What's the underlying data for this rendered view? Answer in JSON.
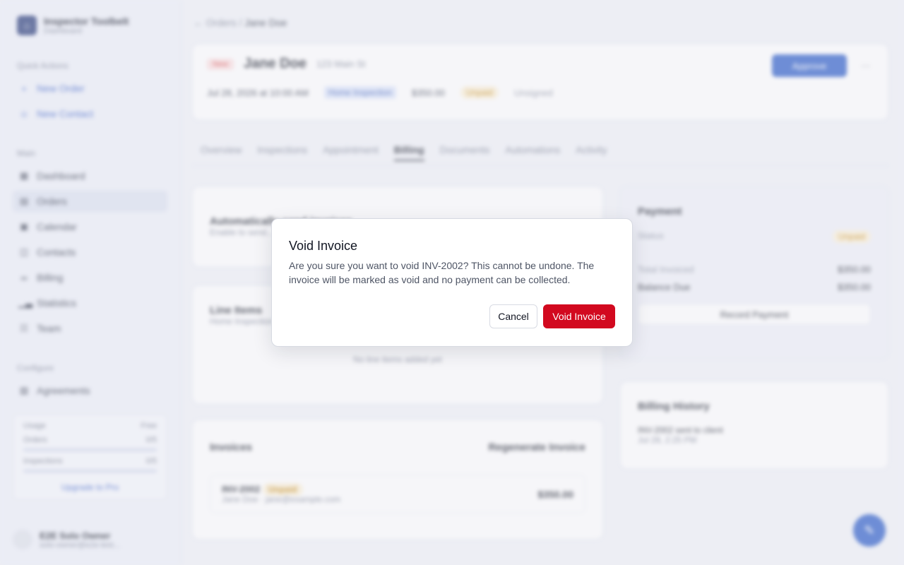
{
  "sidebar": {
    "brand_name": "Inspector Toolbelt",
    "brand_sub": "Dashboard",
    "quick_actions_label": "Quick Actions",
    "quick_actions": [
      {
        "label": "New Order"
      },
      {
        "label": "New Contact"
      }
    ],
    "main_label": "Main",
    "main_items": [
      {
        "label": "Dashboard"
      },
      {
        "label": "Orders"
      },
      {
        "label": "Calendar"
      },
      {
        "label": "Contacts"
      },
      {
        "label": "Billing"
      },
      {
        "label": "Statistics"
      },
      {
        "label": "Team"
      }
    ],
    "configure_label": "Configure",
    "configure_items": [
      {
        "label": "Agreements"
      }
    ],
    "usage": {
      "title": "Usage",
      "plan": "Free",
      "orders_label": "Orders",
      "orders_value": "0/5",
      "inspections_label": "Inspections",
      "inspections_value": "0/5",
      "upgrade_label": "Upgrade to Pro"
    },
    "user": {
      "name": "E2E Solo Owner",
      "email": "solo-owner@e2e-test..."
    }
  },
  "main": {
    "breadcrumb": {
      "parent": "Orders",
      "current": "Jane Doe"
    },
    "header": {
      "status": "New",
      "name": "Jane Doe",
      "address": "123 Main St",
      "approve_label": "Approve",
      "date": "Jul 28, 2026 at 10:00 AM",
      "service": "Home Inspection",
      "amount": "$350.00",
      "payment_status": "Unpaid",
      "assignment": "Unsigned"
    },
    "tabs": [
      "Overview",
      "Inspections",
      "Appointment",
      "Billing",
      "Documents",
      "Automations",
      "Activity"
    ],
    "automation_card": {
      "title": "Automatically send invoices",
      "subtitle": "Enable to send..."
    },
    "line_items": {
      "title": "Line Items",
      "subtitle": "Home Inspection",
      "empty": "No line items added yet"
    },
    "invoices": {
      "title": "Invoices",
      "regenerate_label": "Regenerate Invoice",
      "row": {
        "number": "INV-2002",
        "status": "Unpaid",
        "contact": "Jane Doe · jane@example.com",
        "amount": "$350.00"
      }
    },
    "payment": {
      "title": "Payment",
      "status_label": "Status",
      "status_value": "Unpaid",
      "total_label": "Total Invoiced",
      "total_value": "$350.00",
      "balance_label": "Balance Due",
      "balance_value": "$350.00",
      "record_label": "Record Payment"
    },
    "history": {
      "title": "Billing History",
      "entry": "INV-2002 sent to client",
      "entry_time": "Jul 28, 2:25 PM"
    }
  },
  "dialog": {
    "title": "Void Invoice",
    "description": "Are you sure you want to void INV-2002? This cannot be undone. The invoice will be marked as void and no payment can be collected.",
    "cancel_label": "Cancel",
    "confirm_label": "Void Invoice",
    "confirm_color": "#d2091f"
  }
}
